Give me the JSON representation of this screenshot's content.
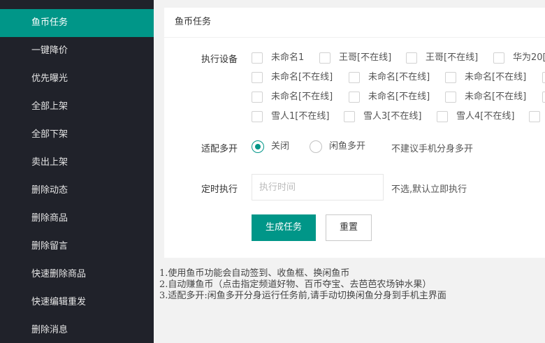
{
  "sidebar": {
    "items": [
      {
        "label": "鱼币任务",
        "active": true
      },
      {
        "label": "一键降价"
      },
      {
        "label": "优先曝光"
      },
      {
        "label": "全部上架"
      },
      {
        "label": "全部下架"
      },
      {
        "label": "卖出上架"
      },
      {
        "label": "删除动态"
      },
      {
        "label": "删除商品"
      },
      {
        "label": "删除留言"
      },
      {
        "label": "快速删除商品"
      },
      {
        "label": "快速编辑重发"
      },
      {
        "label": "删除消息"
      }
    ]
  },
  "panel": {
    "title": "鱼币任务",
    "devices": {
      "label": "执行设备",
      "rows": [
        [
          "未命名1",
          "王哥[不在线]",
          "王哥[不在线]",
          "华为20["
        ],
        [
          "未命名[不在线]",
          "未命名[不在线]",
          "未命名[不在线]",
          ""
        ],
        [
          "未命名[不在线]",
          "未命名[不在线]",
          "未命名[不在线]",
          ""
        ],
        [
          "雪人1[不在线]",
          "雪人3[不在线]",
          "雪人4[不在线]",
          ""
        ]
      ]
    },
    "multi_open": {
      "label": "适配多开",
      "option_off": "关闭",
      "option_on": "闲鱼多开",
      "selected": "关闭",
      "hint": "不建议手机分身多开"
    },
    "schedule": {
      "label": "定时执行",
      "placeholder": "执行时间",
      "value": "",
      "hint": "不选,默认立即执行"
    },
    "buttons": {
      "generate": "生成任务",
      "reset": "重置"
    }
  },
  "notes": [
    "1.使用鱼币功能会自动签到、收鱼框、换闲鱼币",
    "2.自动赚鱼币（点击指定频道好物、百币夺宝、去芭芭农场钟水果）",
    "3.适配多开:闲鱼多开分身运行任务前,请手动切换闲鱼分身到手机主界面"
  ],
  "colors": {
    "accent": "#009688",
    "sidebar_bg": "#20222a"
  }
}
